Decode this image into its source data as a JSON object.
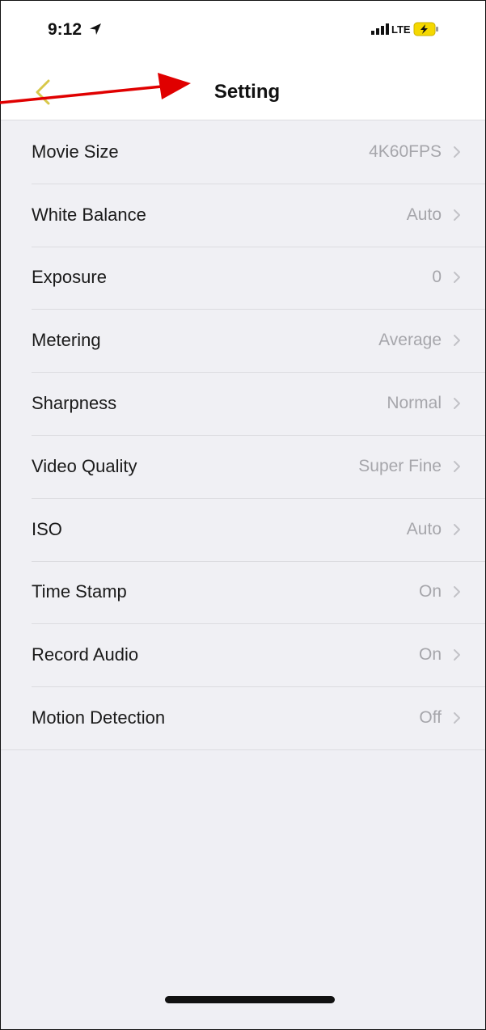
{
  "status_bar": {
    "time": "9:12",
    "network": "LTE"
  },
  "nav": {
    "title": "Setting",
    "back_icon": "chevron-left-icon"
  },
  "settings": [
    {
      "label": "Movie Size",
      "value": "4K60FPS"
    },
    {
      "label": "White Balance",
      "value": "Auto"
    },
    {
      "label": "Exposure",
      "value": "0"
    },
    {
      "label": "Metering",
      "value": "Average"
    },
    {
      "label": "Sharpness",
      "value": "Normal"
    },
    {
      "label": "Video Quality",
      "value": "Super Fine"
    },
    {
      "label": "ISO",
      "value": "Auto"
    },
    {
      "label": "Time Stamp",
      "value": "On"
    },
    {
      "label": "Record Audio",
      "value": "On"
    },
    {
      "label": "Motion Detection",
      "value": "Off"
    }
  ],
  "colors": {
    "accent_back": "#d8c84a",
    "annotation_arrow": "#e00000",
    "value_text": "#a6a6ab",
    "battery": "#f5d800"
  }
}
